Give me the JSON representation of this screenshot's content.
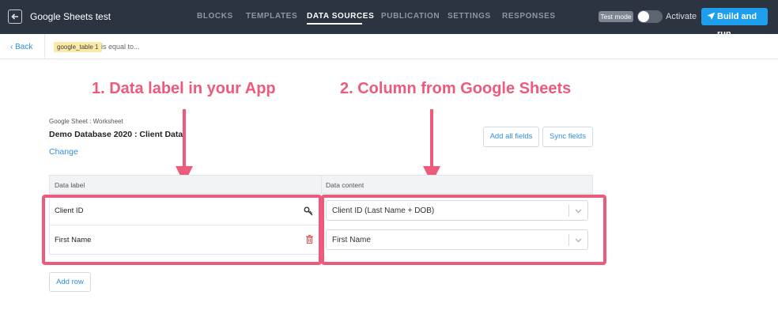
{
  "header": {
    "app_title": "Google Sheets test",
    "nav": [
      "BLOCKS",
      "TEMPLATES",
      "DATA SOURCES",
      "PUBLICATION",
      "SETTINGS",
      "RESPONSES"
    ],
    "active_nav": "DATA SOURCES",
    "test_mode_badge": "Test mode",
    "activate_label": "Activate",
    "activate_on": false,
    "build_button": "Build and run"
  },
  "subbar": {
    "back_label": "‹ Back",
    "tag": "google_table 1",
    "condition_text": "is equal to..."
  },
  "annotations": {
    "left": "1. Data label in your App",
    "right": "2. Column from Google Sheets"
  },
  "sheet": {
    "caption": "Google Sheet : Worksheet",
    "name": "Demo Database 2020 : Client Data",
    "change_label": "Change"
  },
  "actions": {
    "add_all_fields": "Add all fields",
    "sync_fields": "Sync fields",
    "add_row": "Add row"
  },
  "table": {
    "columns": [
      "Data label",
      "Data content"
    ],
    "rows": [
      {
        "label": "Client ID",
        "icon": "key-icon",
        "content": "Client ID (Last Name + DOB)"
      },
      {
        "label": "First Name",
        "icon": "trash-icon",
        "content": "First Name"
      }
    ]
  },
  "colors": {
    "topbar": "#2b3440",
    "accent": "#1e9fee",
    "highlight": "#ee5a7b",
    "tag": "#fbe9a6"
  }
}
